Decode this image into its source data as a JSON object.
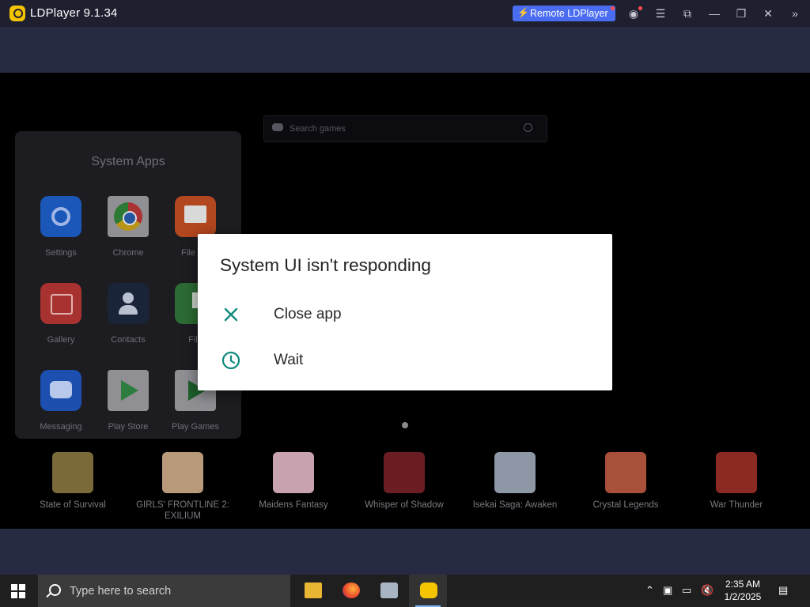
{
  "titlebar": {
    "app_title": "LDPlayer 9.1.34",
    "remote_button": "Remote LDPlayer",
    "icons": [
      "user-icon",
      "menu-icon",
      "shrink-icon",
      "minimize-icon",
      "restore-icon",
      "close-icon",
      "expand-sidebar-icon"
    ]
  },
  "search_games": {
    "placeholder": "Search games"
  },
  "system_apps": {
    "title": "System Apps",
    "apps": [
      {
        "label": "Settings",
        "icon": "settings-icon"
      },
      {
        "label": "Chrome",
        "icon": "chrome-icon"
      },
      {
        "label": "File Ma",
        "icon": "file-manager-icon"
      },
      {
        "label": "Gallery",
        "icon": "gallery-icon"
      },
      {
        "label": "Contacts",
        "icon": "contacts-icon"
      },
      {
        "label": "File",
        "icon": "downloads-icon"
      },
      {
        "label": "Messaging",
        "icon": "messaging-icon"
      },
      {
        "label": "Play Store",
        "icon": "play-store-icon"
      },
      {
        "label": "Play Games",
        "icon": "play-games-icon"
      }
    ]
  },
  "games": [
    {
      "label": "State of Survival",
      "color": "#7a6a3a"
    },
    {
      "label": "GIRLS' FRONTLINE 2: EXILIUM",
      "color": "#b89a7a"
    },
    {
      "label": "Maidens Fantasy",
      "color": "#c9a2b0"
    },
    {
      "label": "Whisper of Shadow",
      "color": "#6a1e24"
    },
    {
      "label": "Isekai Saga: Awaken",
      "color": "#8d97a6"
    },
    {
      "label": "Crystal Legends",
      "color": "#a8503a"
    },
    {
      "label": "War Thunder",
      "color": "#8a2a22"
    }
  ],
  "dialog": {
    "title": "System UI isn't responding",
    "options": [
      {
        "label": "Close app",
        "icon": "close-app-icon"
      },
      {
        "label": "Wait",
        "icon": "clock-icon"
      }
    ],
    "accent": "#0f8a7e"
  },
  "taskbar": {
    "search_placeholder": "Type here to search",
    "time": "2:35 AM",
    "date": "1/2/2025"
  }
}
